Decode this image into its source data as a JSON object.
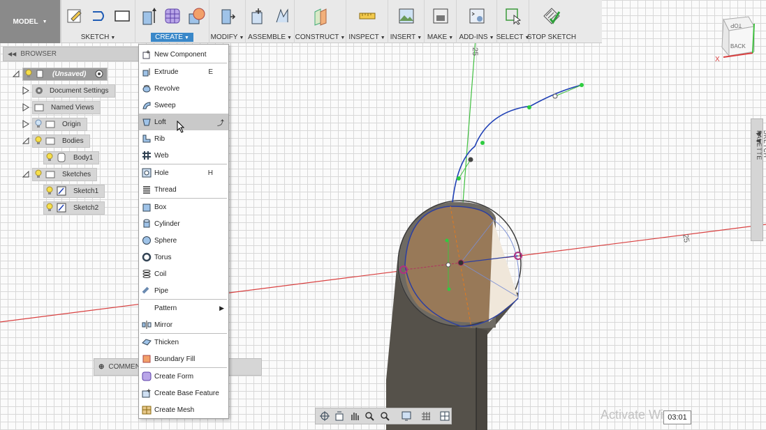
{
  "toolbar": {
    "model": "MODEL",
    "groups": {
      "sketch": "SKETCH",
      "create": "CREATE",
      "modify": "MODIFY",
      "assemble": "ASSEMBLE",
      "construct": "CONSTRUCT",
      "inspect": "INSPECT",
      "insert": "INSERT",
      "make": "MAKE",
      "addins": "ADD-INS",
      "select": "SELECT",
      "stop_sketch": "STOP SKETCH"
    }
  },
  "browser": {
    "title": "BROWSER",
    "root": "(Unsaved)",
    "items": {
      "doc_settings": "Document Settings",
      "named_views": "Named Views",
      "origin": "Origin",
      "bodies": "Bodies",
      "body1": "Body1",
      "sketches": "Sketches",
      "sketch1": "Sketch1",
      "sketch2": "Sketch2"
    }
  },
  "comments": "COMMENTS",
  "create_menu": {
    "new_component": "New Component",
    "extrude": "Extrude",
    "extrude_key": "E",
    "revolve": "Revolve",
    "sweep": "Sweep",
    "loft": "Loft",
    "rib": "Rib",
    "web": "Web",
    "hole": "Hole",
    "hole_key": "H",
    "thread": "Thread",
    "box": "Box",
    "cylinder": "Cylinder",
    "sphere": "Sphere",
    "torus": "Torus",
    "coil": "Coil",
    "pipe": "Pipe",
    "pattern": "Pattern",
    "mirror": "Mirror",
    "thicken": "Thicken",
    "boundary_fill": "Boundary Fill",
    "create_form": "Create Form",
    "create_base_feature": "Create Base Feature",
    "create_mesh": "Create Mesh"
  },
  "sketch_palette": "SKETCH PALETTE",
  "viewcube": {
    "top": "TOP",
    "back": "BACK",
    "x": "X"
  },
  "axis_labels": {
    "y_dim": "25",
    "x_dim": "25"
  },
  "watermark": "Activate Win",
  "timer": "03:01",
  "colors": {
    "accent": "#3a88c9",
    "sketch_curve": "#1e3fb5",
    "point": "#2ecc40",
    "axis_red": "#d94040",
    "axis_green": "#3fbf3f"
  }
}
